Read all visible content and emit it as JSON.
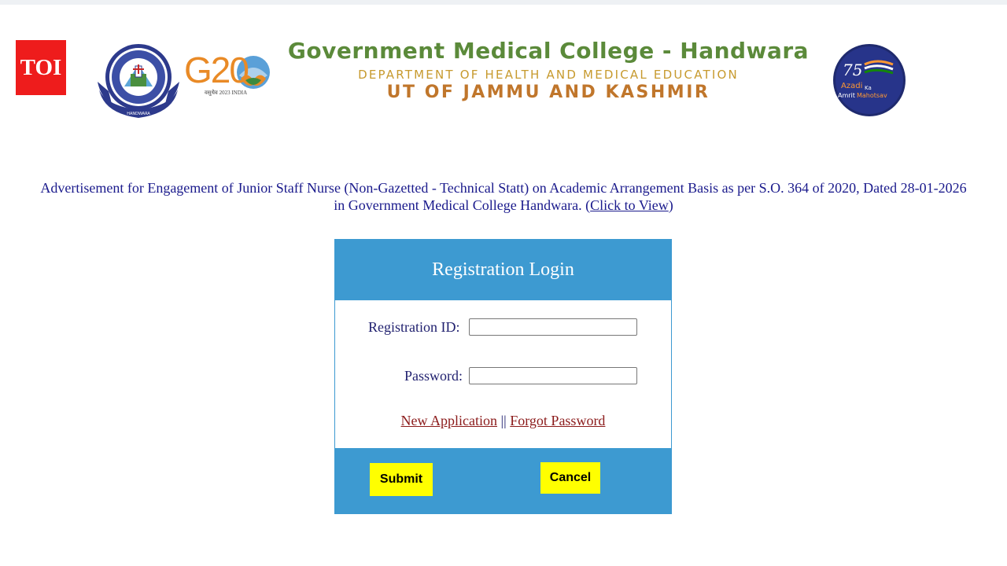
{
  "header": {
    "toi_label": "TOI",
    "g20_label": "G20",
    "g20_sub": "वसुधैव 2023 INDIA",
    "title": "Government Medical College - Handwara",
    "department": "DEPARTMENT OF HEALTH AND MEDICAL EDUCATION",
    "ut": "UT OF JAMMU AND KASHMIR",
    "amrit_top": "75",
    "amrit_line1": "Azadi",
    "amrit_ka": "Ka",
    "amrit_line2": "Amrit",
    "amrit_mahotsav": "Mahotsav"
  },
  "advertisement": {
    "line1": "Advertisement for Engagement of Junior Staff Nurse (Non-Gazetted - Technical Statt) on Academic Arrangement Basis as per S.O. 364 of 2020, Dated 28-01-2026",
    "line2_prefix": "in Government Medical College Handwara. (",
    "link_text": "Click to View",
    "line2_suffix": ")"
  },
  "login": {
    "title": "Registration Login",
    "registration_id_label": "Registration ID:",
    "registration_id_value": "",
    "password_label": "Password:",
    "password_value": "",
    "new_application_link": "New Application",
    "separator": "||",
    "forgot_password_link": "Forgot Password",
    "submit_label": "Submit",
    "cancel_label": "Cancel"
  },
  "colors": {
    "accent_blue": "#3d9ad1",
    "button_yellow": "#ffff00",
    "toi_red": "#ee1c1c",
    "link_maroon": "#8b1a1a",
    "advert_blue": "#1a1a8c"
  }
}
